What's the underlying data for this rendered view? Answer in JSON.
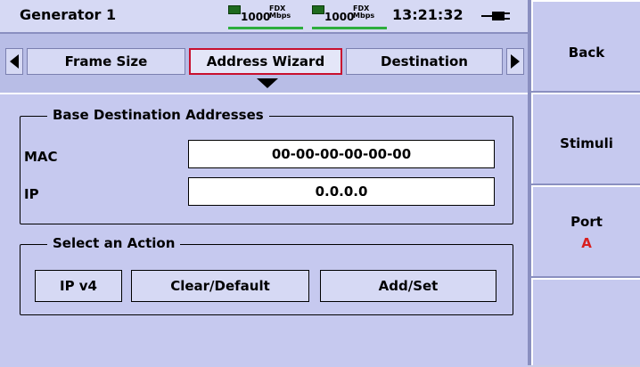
{
  "header": {
    "title": "Generator 1",
    "links": [
      {
        "speed": "1000",
        "duplex": "FDX",
        "unit": "Mbps"
      },
      {
        "speed": "1000",
        "duplex": "FDX",
        "unit": "Mbps"
      }
    ],
    "clock": "13:21:32",
    "power_icon": "plug-icon"
  },
  "tabs": {
    "items": [
      "Frame Size",
      "Address Wizard",
      "Destination"
    ],
    "selected": "Address Wizard"
  },
  "base_addresses": {
    "legend": "Base Destination Addresses",
    "mac_label": "MAC",
    "mac_value": "00-00-00-00-00-00",
    "ip_label": "IP",
    "ip_value": "0.0.0.0"
  },
  "actions": {
    "legend": "Select an Action",
    "ipv4": "IP v4",
    "clear_default": "Clear/Default",
    "add_set": "Add/Set"
  },
  "softkeys": {
    "back": "Back",
    "stimuli": "Stimuli",
    "port_label": "Port",
    "port_value": "A"
  },
  "colors": {
    "selected_tab_border": "#c8102e",
    "port_value": "#d81f1f",
    "link_bar": "#2dae3d"
  }
}
